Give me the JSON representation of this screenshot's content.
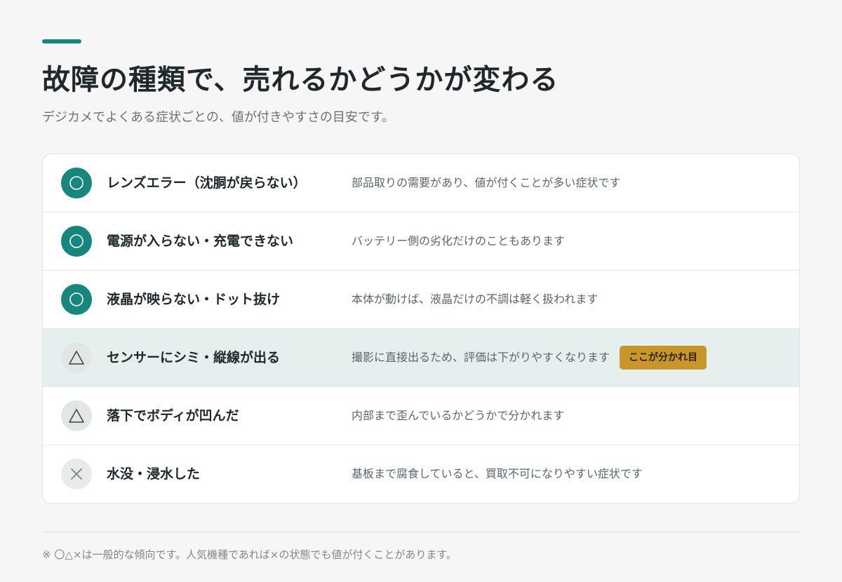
{
  "header": {
    "title": "故障の種類で、売れるかどうかが変わる",
    "subtitle": "デジカメでよくある症状ごとの、値が付きやすさの目安です。"
  },
  "colors": {
    "accent": "#17867c",
    "highlight_row": "#e5efed",
    "tag": "#c9962a"
  },
  "rows": [
    {
      "rating": "〇",
      "icon": "circle-icon",
      "symptom": "レンズエラー（沈胴が戻らない）",
      "note": "部品取りの需要があり、値が付くことが多い症状です"
    },
    {
      "rating": "〇",
      "icon": "circle-icon",
      "symptom": "電源が入らない・充電できない",
      "note": "バッテリー側の劣化だけのこともあります"
    },
    {
      "rating": "〇",
      "icon": "circle-icon",
      "symptom": "液晶が映らない・ドット抜け",
      "note": "本体が動けば、液晶だけの不調は軽く扱われます"
    },
    {
      "rating": "△",
      "icon": "triangle-icon",
      "symptom": "センサーにシミ・縦線が出る",
      "note": "撮影に直接出るため、評価は下がりやすくなります",
      "tag": "ここが分かれ目"
    },
    {
      "rating": "△",
      "icon": "triangle-icon",
      "symptom": "落下でボディが凹んだ",
      "note": "内部まで歪んでいるかどうかで分かれます"
    },
    {
      "rating": "×",
      "icon": "cross-icon",
      "symptom": "水没・浸水した",
      "note": "基板まで腐食していると、買取不可になりやすい症状です"
    }
  ],
  "footer": {
    "note": "※ 〇△×は一般的な傾向です。人気機種であれば×の状態でも値が付くことがあります。"
  }
}
